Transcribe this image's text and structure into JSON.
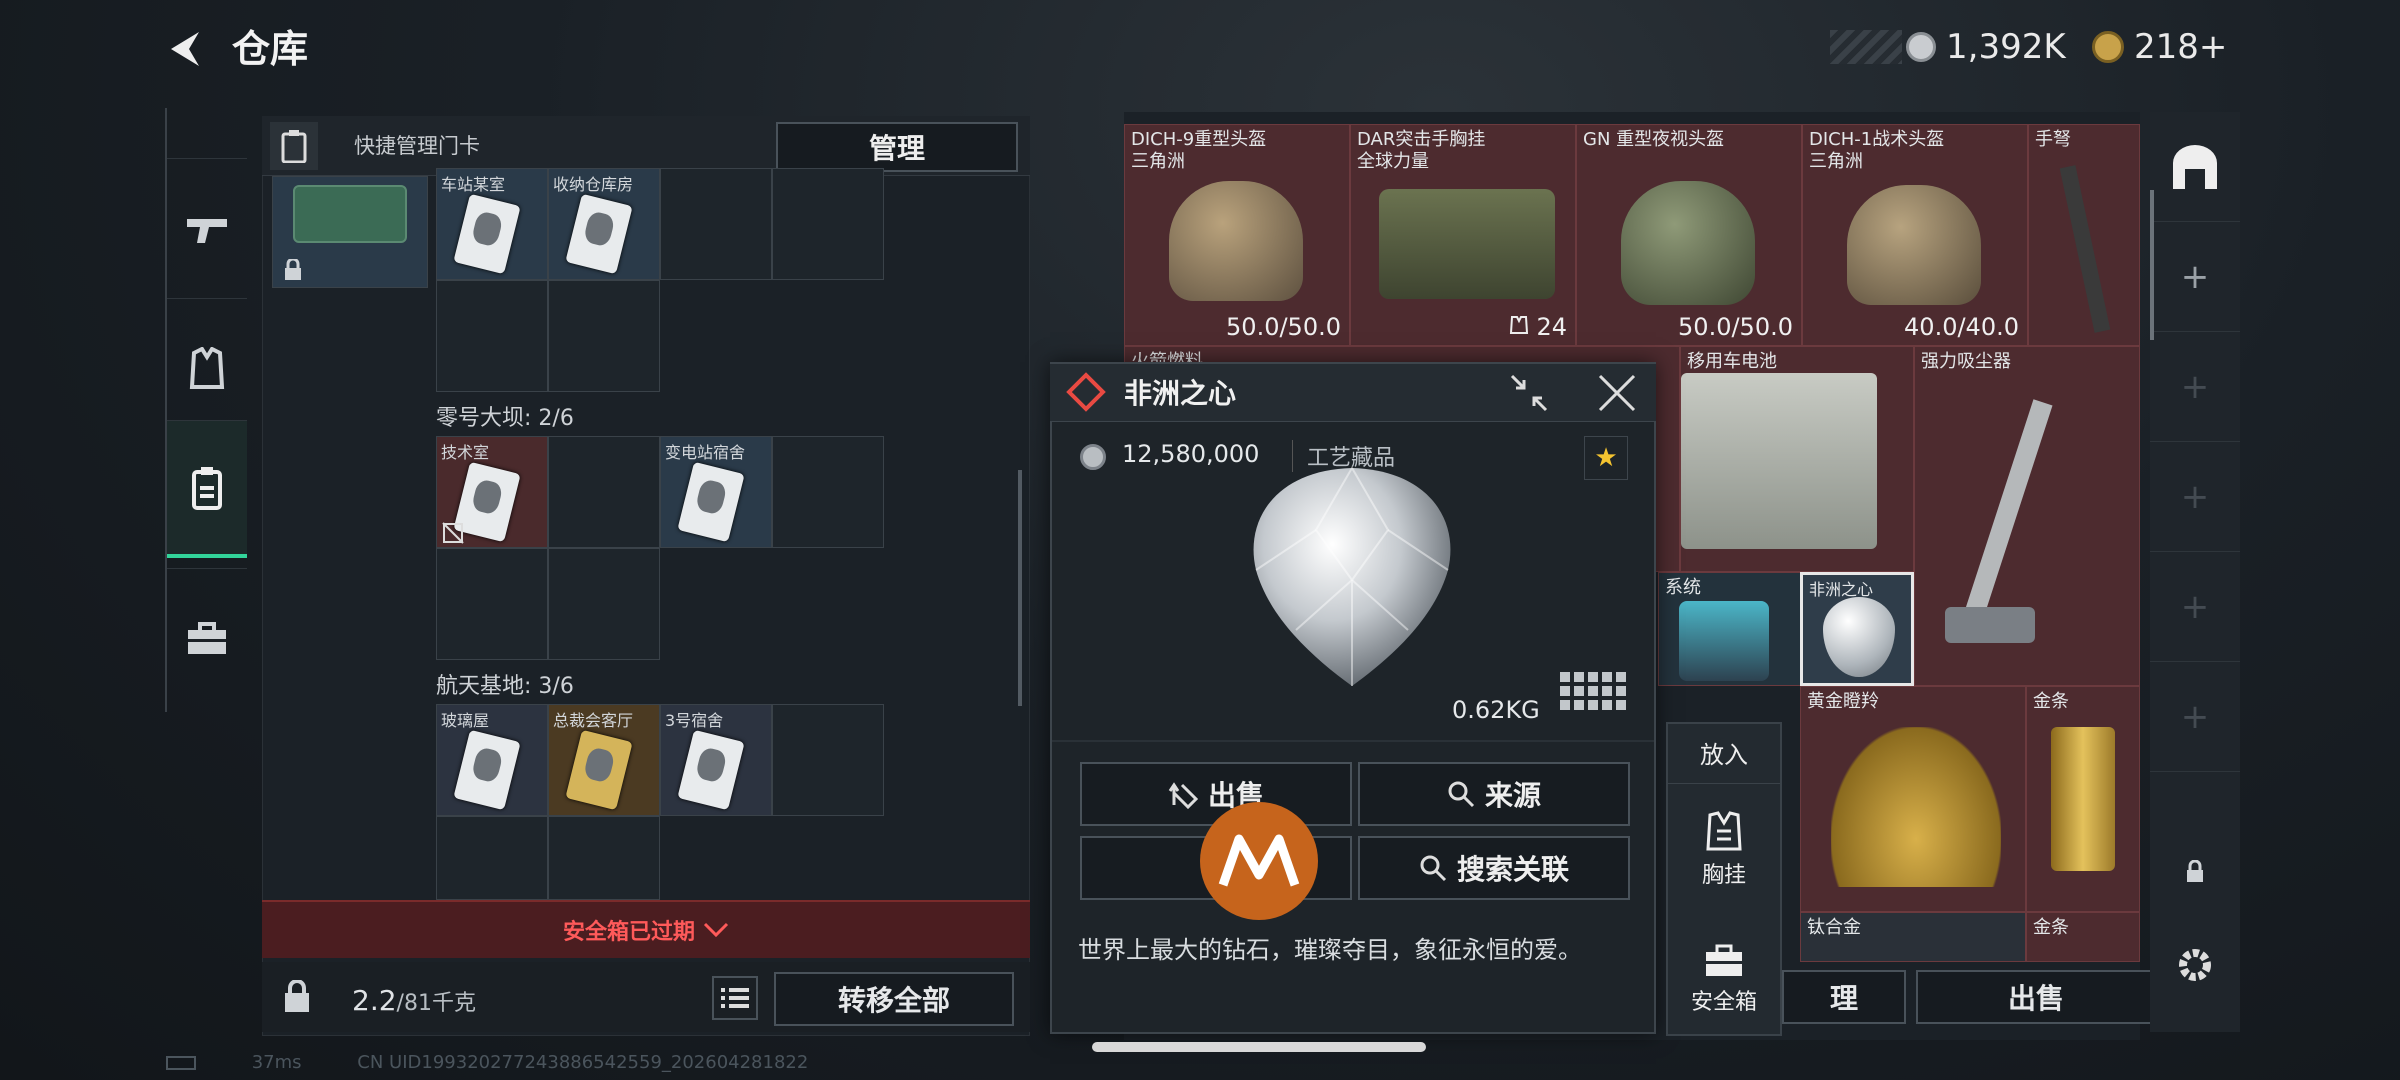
{
  "header": {
    "title": "仓库",
    "currency1": "1,392K",
    "currency2": "218+"
  },
  "keycard_bar": {
    "label": "快捷管理门卡",
    "manage_button": "管理"
  },
  "left_panel": {
    "top_row_labels": [
      "车站某室",
      "收纳仓库房"
    ],
    "section2": "零号大坝: 2/6",
    "section2_items": [
      "技术室",
      "变电站宿舍"
    ],
    "section3": "航天基地: 3/6",
    "section3_items": [
      "玻璃屋",
      "总裁会客厅",
      "3号宿舍"
    ],
    "expired_text": "安全箱已过期",
    "weight": "2.2",
    "weight_max": "/81千克",
    "transfer_button": "转移全部"
  },
  "right_grid": {
    "items": [
      {
        "name": "DICH-9重型头盔",
        "sub": "三角洲",
        "value": "50.0/50.0"
      },
      {
        "name": "DAR突击手胸挂",
        "sub": "全球力量",
        "value": "24"
      },
      {
        "name": "GN 重型夜视头盔",
        "sub": "",
        "value": "50.0/50.0"
      },
      {
        "name": "DICH-1战术头盔",
        "sub": "三角洲",
        "value": "40.0/40.0"
      },
      {
        "name": "手弩",
        "sub": "",
        "value": ""
      },
      {
        "name": "火箭燃料",
        "sub": "",
        "value": ""
      },
      {
        "name": "移用车电池",
        "sub": "",
        "value": ""
      },
      {
        "name": "强力吸尘器",
        "sub": "",
        "value": ""
      },
      {
        "name": "系统",
        "sub": "",
        "value": ""
      },
      {
        "name": "非洲之心",
        "sub": "",
        "value": ""
      },
      {
        "name": "黄金瞪羚",
        "sub": "",
        "value": ""
      },
      {
        "name": "金条",
        "sub": "",
        "value": ""
      },
      {
        "name": "钛合金",
        "sub": "",
        "value": ""
      },
      {
        "name": "金条",
        "sub": "",
        "value": ""
      }
    ],
    "sort_button": "理",
    "sell_button": "出售"
  },
  "popup": {
    "title": "非洲之心",
    "price": "12,580,000",
    "category": "工艺藏品",
    "weight": "0.62KG",
    "sell_button": "出售",
    "source_button": "来源",
    "help_button": "?",
    "search_button": "搜索关联",
    "description": "世界上最大的钻石，璀璨夺目，象征永恒的爱。"
  },
  "context_menu": {
    "put_in": "放入",
    "vest": "胸挂",
    "safebox": "安全箱"
  },
  "status_bar": {
    "ping": "37ms",
    "uid": "CN UID1993202772438865425​59_202604281822"
  },
  "colors": {
    "accent_green": "#32d49a",
    "danger_red": "#ff5a5a",
    "brand_orange": "#c6641c"
  }
}
